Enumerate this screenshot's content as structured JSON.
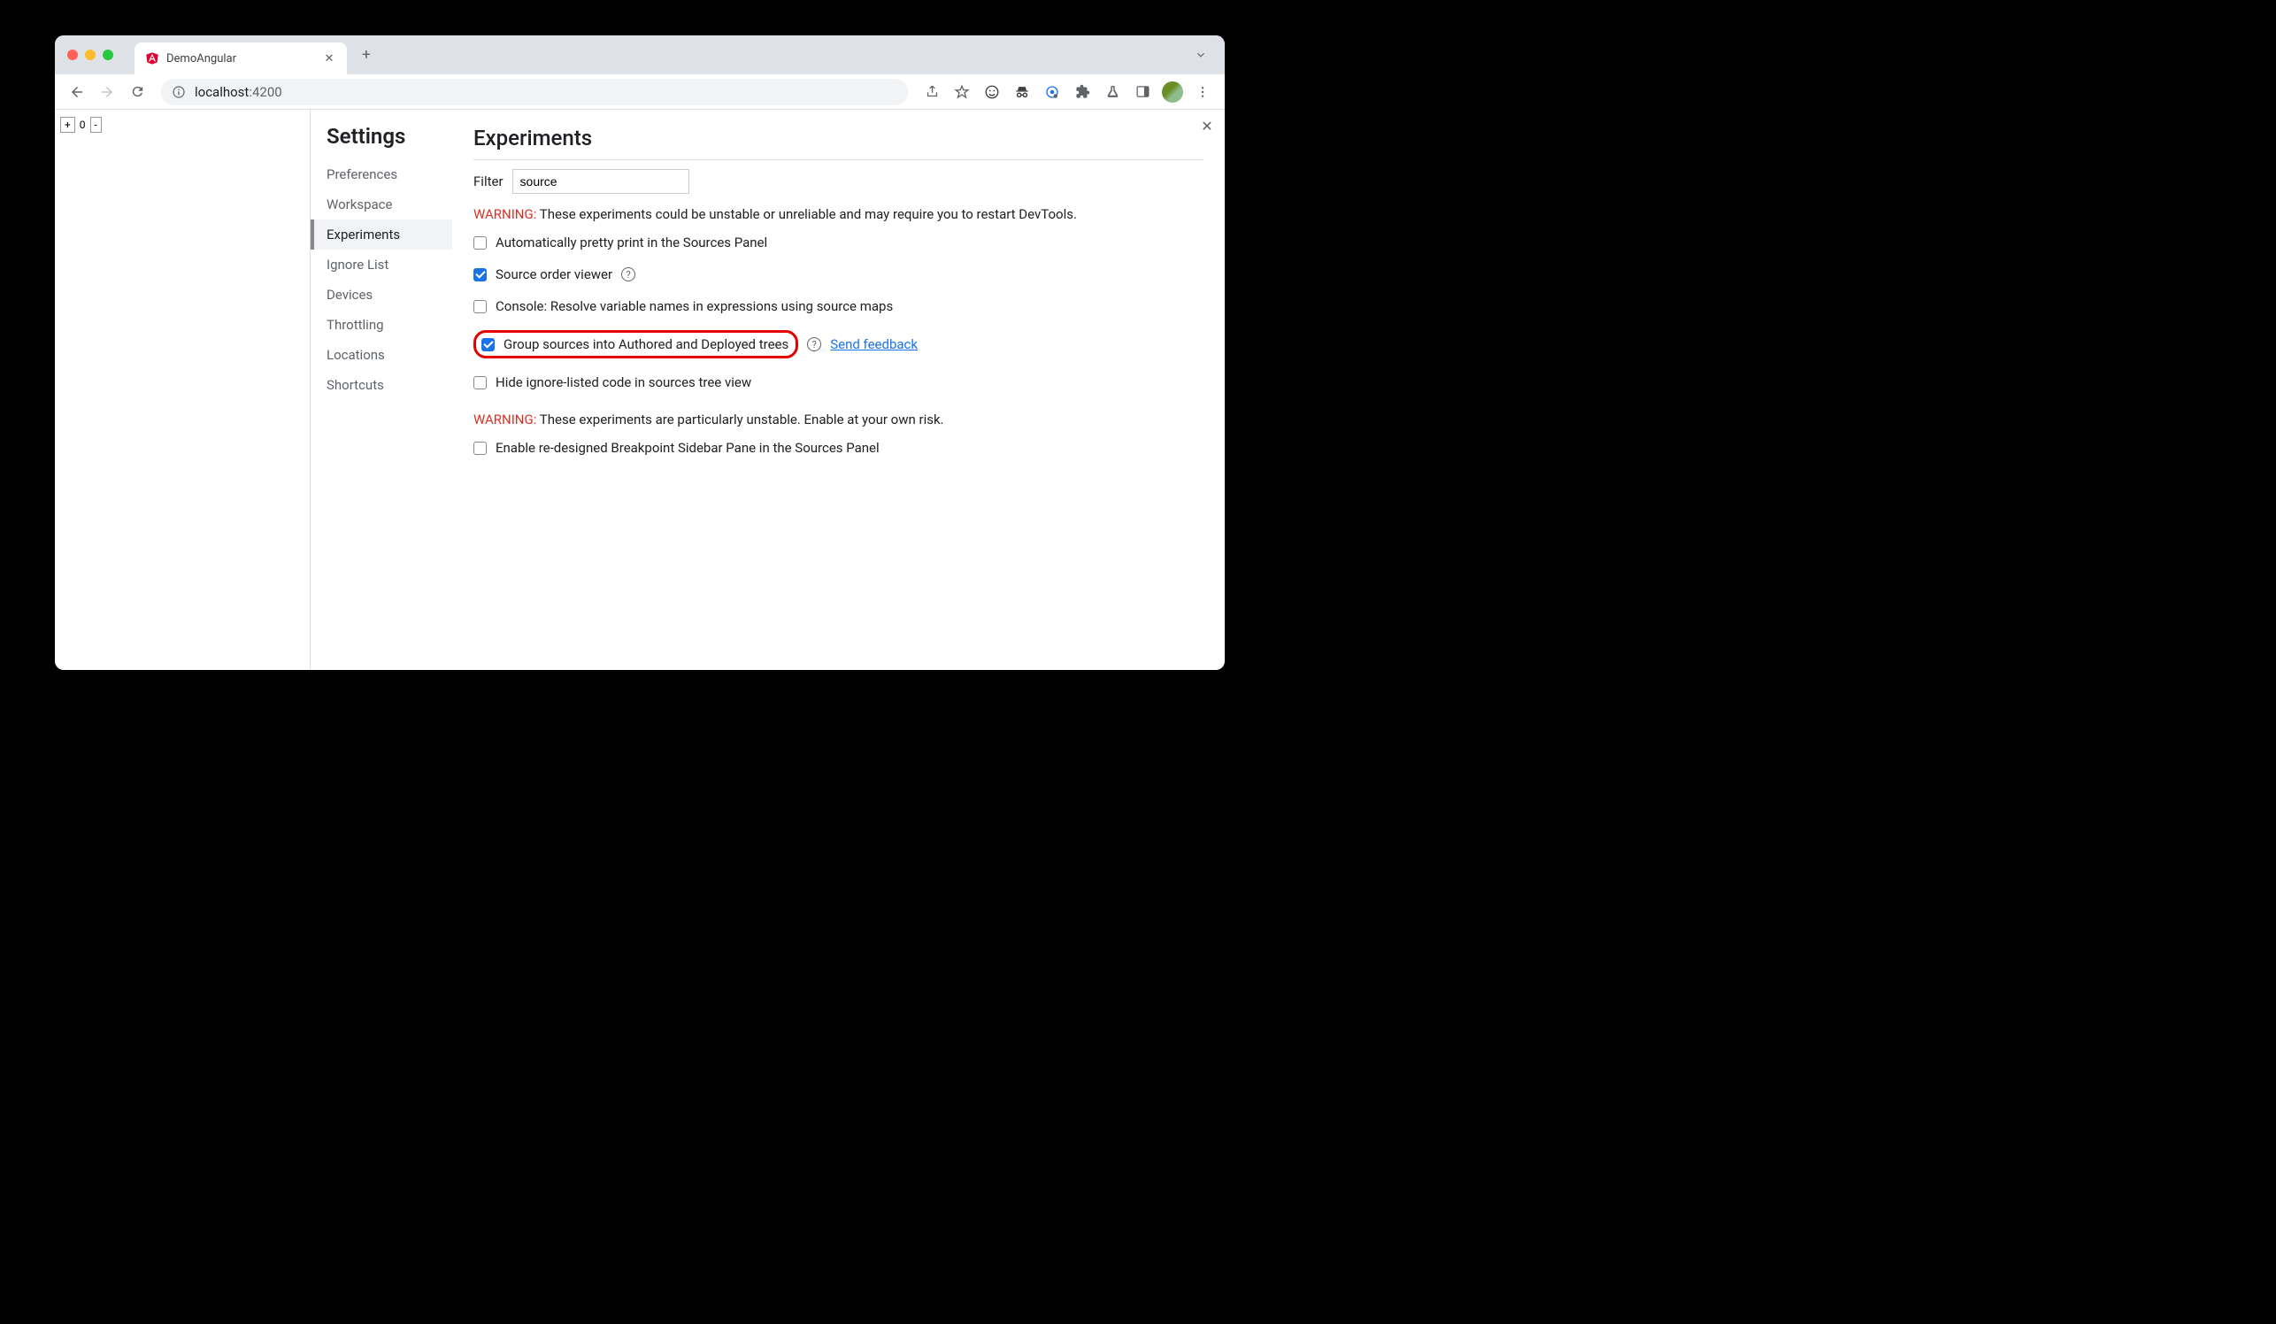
{
  "tab": {
    "title": "DemoAngular"
  },
  "url": {
    "host": "localhost",
    "port": ":4200"
  },
  "page": {
    "count": "0"
  },
  "settings": {
    "title": "Settings",
    "nav": [
      {
        "label": "Preferences"
      },
      {
        "label": "Workspace"
      },
      {
        "label": "Experiments"
      },
      {
        "label": "Ignore List"
      },
      {
        "label": "Devices"
      },
      {
        "label": "Throttling"
      },
      {
        "label": "Locations"
      },
      {
        "label": "Shortcuts"
      }
    ]
  },
  "experiments": {
    "heading": "Experiments",
    "filter_label": "Filter",
    "filter_value": "source",
    "warning1_label": "WARNING:",
    "warning1_text": " These experiments could be unstable or unreliable and may require you to restart DevTools.",
    "items": [
      {
        "label": "Automatically pretty print in the Sources Panel"
      },
      {
        "label": "Source order viewer"
      },
      {
        "label": "Console: Resolve variable names in expressions using source maps"
      },
      {
        "label": "Group sources into Authored and Deployed trees"
      },
      {
        "label": "Hide ignore-listed code in sources tree view"
      }
    ],
    "feedback": "Send feedback",
    "warning2_label": "WARNING:",
    "warning2_text": " These experiments are particularly unstable. Enable at your own risk.",
    "items2": [
      {
        "label": "Enable re-designed Breakpoint Sidebar Pane in the Sources Panel"
      }
    ]
  }
}
